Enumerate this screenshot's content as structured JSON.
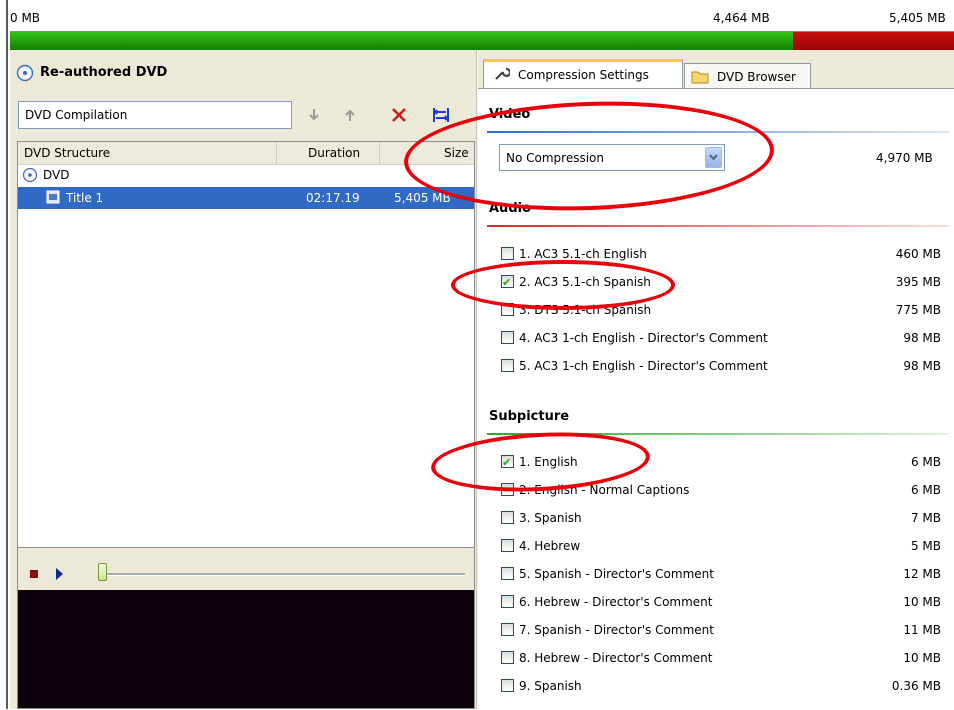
{
  "capacity": {
    "left_label": "0 MB",
    "mid_label": "4,464 MB",
    "right_label": "5,405 MB",
    "used_fraction": 0.829,
    "ok_color": "#22a810",
    "over_color": "#b00808"
  },
  "left": {
    "title": "Re-authored DVD",
    "title_icon": "dvd-disc-icon",
    "compilation_name": "DVD Compilation",
    "toolbar": {
      "down_icon": "arrow-down-icon",
      "up_icon": "arrow-up-icon",
      "delete_icon": "delete-x-icon",
      "fit_icon": "fit-to-disc-icon"
    },
    "columns": [
      "DVD Structure",
      "Duration",
      "Size"
    ],
    "tree_root": "DVD",
    "title_row": {
      "name": "Title 1",
      "duration": "02:17.19",
      "size": "5,405 MB"
    },
    "player": {
      "stop_icon": "stop-icon",
      "play_icon": "play-icon",
      "slider_value": 0
    }
  },
  "right": {
    "tabs": [
      {
        "label": "Compression Settings",
        "icon": "wrench-icon",
        "active": true
      },
      {
        "label": "DVD Browser",
        "icon": "folder-icon",
        "active": false
      }
    ],
    "video": {
      "heading": "Video",
      "select_value": "No Compression",
      "size": "4,970 MB"
    },
    "audio": {
      "heading": "Audio",
      "items": [
        {
          "label": "1. AC3 5.1-ch English",
          "size": "460 MB",
          "checked": false
        },
        {
          "label": "2. AC3 5.1-ch Spanish",
          "size": "395 MB",
          "checked": true
        },
        {
          "label": "3. DTS 5.1-ch Spanish",
          "size": "775 MB",
          "checked": false
        },
        {
          "label": "4. AC3 1-ch English - Director's Comment",
          "size": "98 MB",
          "checked": false
        },
        {
          "label": "5. AC3 1-ch English - Director's Comment",
          "size": "98 MB",
          "checked": false
        }
      ]
    },
    "subpicture": {
      "heading": "Subpicture",
      "items": [
        {
          "label": "1. English",
          "size": "6 MB",
          "checked": true
        },
        {
          "label": "2. English - Normal Captions",
          "size": "6 MB",
          "checked": false
        },
        {
          "label": "3. Spanish",
          "size": "7 MB",
          "checked": false
        },
        {
          "label": "4. Hebrew",
          "size": "5 MB",
          "checked": false
        },
        {
          "label": "5. Spanish - Director's Comment",
          "size": "12 MB",
          "checked": false
        },
        {
          "label": "6. Hebrew - Director's Comment",
          "size": "10 MB",
          "checked": false
        },
        {
          "label": "7. Spanish - Director's Comment",
          "size": "11 MB",
          "checked": false
        },
        {
          "label": "8. Hebrew - Director's Comment",
          "size": "10 MB",
          "checked": false
        },
        {
          "label": "9. Spanish",
          "size": "0.36 MB",
          "checked": false
        }
      ]
    }
  }
}
